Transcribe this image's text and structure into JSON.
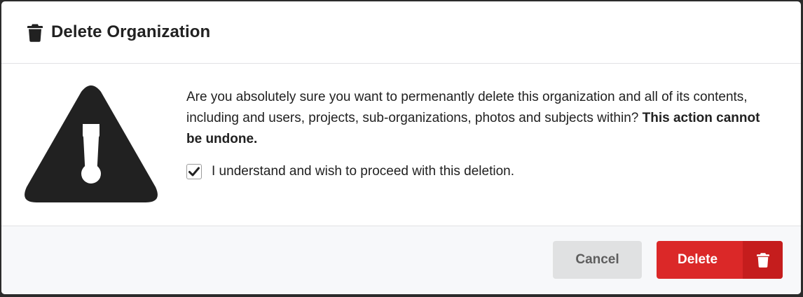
{
  "dialog": {
    "title": "Delete Organization",
    "header_icon": "trash-icon",
    "warning_icon": "warning-triangle-icon"
  },
  "body": {
    "message_text": "Are you absolutely sure you want to permenantly delete this organization and all of its contents, including and users, projects, sub-organizations, photos and subjects within? ",
    "message_emphasis": "This action cannot be undone.",
    "confirm_label": "I understand and wish to proceed with this deletion.",
    "confirm_checked": true
  },
  "footer": {
    "cancel_label": "Cancel",
    "delete_label": "Delete",
    "delete_icon": "trash-icon"
  },
  "colors": {
    "danger": "#db2828",
    "danger_dark": "#c51d1d",
    "icon_dark": "#212121"
  }
}
